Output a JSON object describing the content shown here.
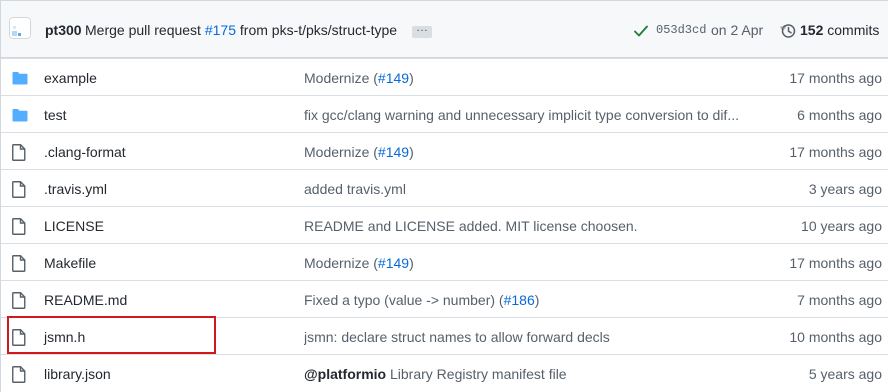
{
  "commit": {
    "author": "pt300",
    "message_prefix": "Merge pull request ",
    "pr_ref": "#175",
    "message_suffix": " from pks-t/pks/struct-type",
    "ellipsis": "…",
    "sha": "053d3cd",
    "date": "on 2 Apr",
    "count": "152",
    "count_label": " commits",
    "status_color": "#1a7f37"
  },
  "files": [
    {
      "type": "folder",
      "icon": "folder-icon",
      "name": "example",
      "msg": [
        {
          "t": "Modernize ("
        },
        {
          "t": "#149",
          "link": true
        },
        {
          "t": ")"
        }
      ],
      "age": "17 months ago"
    },
    {
      "type": "folder",
      "icon": "folder-icon",
      "name": "test",
      "msg": [
        {
          "t": "fix gcc/clang warning and unnecessary implicit type conversion to dif..."
        }
      ],
      "age": "6 months ago"
    },
    {
      "type": "file",
      "icon": "file-icon",
      "name": ".clang-format",
      "msg": [
        {
          "t": "Modernize ("
        },
        {
          "t": "#149",
          "link": true
        },
        {
          "t": ")"
        }
      ],
      "age": "17 months ago"
    },
    {
      "type": "file",
      "icon": "file-icon",
      "name": ".travis.yml",
      "msg": [
        {
          "t": "added travis.yml"
        }
      ],
      "age": "3 years ago"
    },
    {
      "type": "file",
      "icon": "file-icon",
      "name": "LICENSE",
      "msg": [
        {
          "t": "README and LICENSE added. MIT license choosen."
        }
      ],
      "age": "10 years ago"
    },
    {
      "type": "file",
      "icon": "file-icon",
      "name": "Makefile",
      "msg": [
        {
          "t": "Modernize ("
        },
        {
          "t": "#149",
          "link": true
        },
        {
          "t": ")"
        }
      ],
      "age": "17 months ago"
    },
    {
      "type": "file",
      "icon": "file-icon",
      "name": "README.md",
      "msg": [
        {
          "t": "Fixed a typo (value -> number) ("
        },
        {
          "t": "#186",
          "link": true
        },
        {
          "t": ")"
        }
      ],
      "age": "7 months ago"
    },
    {
      "type": "file",
      "icon": "file-icon",
      "name": "jsmn.h",
      "msg": [
        {
          "t": "jsmn: declare struct names to allow forward decls"
        }
      ],
      "age": "10 months ago"
    },
    {
      "type": "file",
      "icon": "file-icon",
      "name": "library.json",
      "msg": [
        {
          "t": "@platformio",
          "mention": true
        },
        {
          "t": " Library Registry manifest file"
        }
      ],
      "age": "5 years ago"
    }
  ],
  "colors": {
    "folder": "#54aeff",
    "file": "#57606a",
    "link": "#0969da",
    "highlight": "#d0191f"
  }
}
